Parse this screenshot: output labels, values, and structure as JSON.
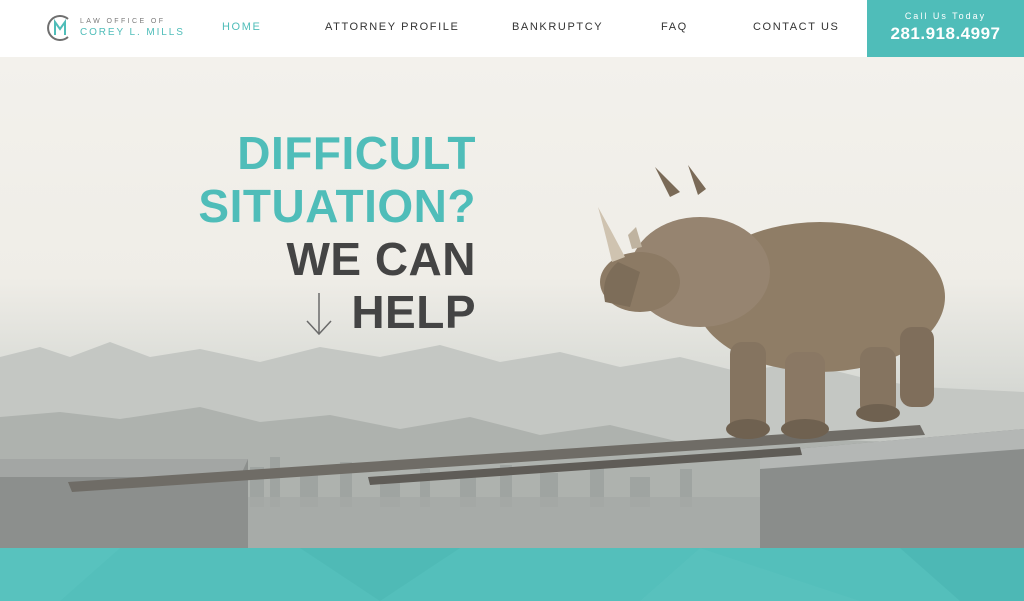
{
  "brand": {
    "line1": "LAW OFFICE OF",
    "line2": "COREY L. MILLS",
    "accent_color": "#4fbdb9",
    "logo_icon": "cm-monogram-icon"
  },
  "nav": {
    "items": [
      {
        "label": "HOME",
        "active": true
      },
      {
        "label": "ATTORNEY PROFILE",
        "active": false
      },
      {
        "label": "BANKRUPTCY",
        "active": false
      },
      {
        "label": "FAQ",
        "active": false
      },
      {
        "label": "CONTACT US",
        "active": false
      }
    ]
  },
  "call": {
    "label": "Call Us Today",
    "phone": "281.918.4997"
  },
  "hero": {
    "line1": "DIFFICULT",
    "line2": "SITUATION?",
    "line3": "WE CAN",
    "line4": "HELP",
    "arrow_icon": "arrow-down-icon",
    "image_subject": "rhino-on-plank-image"
  },
  "colors": {
    "teal": "#4fbdb9",
    "dark_text": "#444444",
    "band": "#54bfbb"
  }
}
